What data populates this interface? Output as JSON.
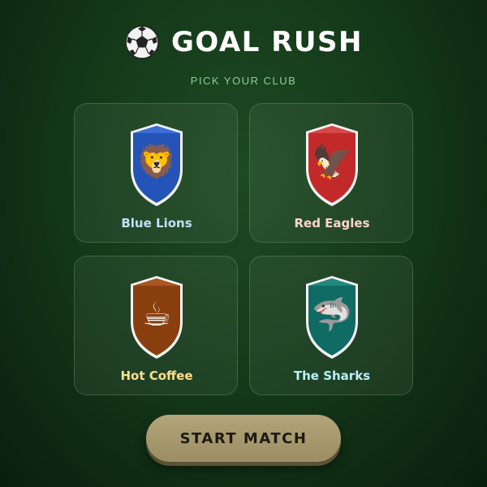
{
  "header": {
    "icon": "soccer-ball-icon",
    "title": "GOAL RUSH",
    "subtitle": "PICK YOUR CLUB"
  },
  "teams": [
    {
      "name": "Blue Lions",
      "emblem": "lion-emblem-icon",
      "emoji": "🦁",
      "crest_color": "#2554b8",
      "crest_top": "#3b6fd6",
      "name_color": "#bfe0ff"
    },
    {
      "name": "Red Eagles",
      "emblem": "eagle-emblem-icon",
      "emoji": "🦅",
      "crest_color": "#c22a2a",
      "crest_top": "#d94848",
      "name_color": "#ffd4cc"
    },
    {
      "name": "Hot Coffee",
      "emblem": "coffee-emblem-icon",
      "emoji": "☕",
      "crest_color": "#8a3f0e",
      "crest_top": "#a8571f",
      "name_color": "#ffe08a"
    },
    {
      "name": "The Sharks",
      "emblem": "shark-emblem-icon",
      "emoji": "🦈",
      "crest_color": "#0f6b63",
      "crest_top": "#218a80",
      "name_color": "#b8f0ff"
    }
  ],
  "actions": {
    "start_label": "START MATCH"
  }
}
